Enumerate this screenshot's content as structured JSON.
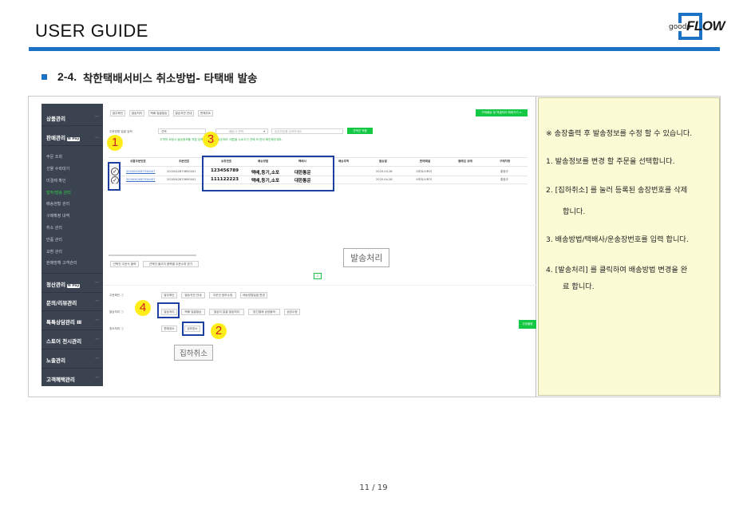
{
  "header": {
    "title": "USER GUIDE",
    "logo_small": "goods",
    "logo_big": "FLOW"
  },
  "section": {
    "number": "2-4.",
    "title": "착한택배서비스 취소방법- 타택배 발송"
  },
  "sidebar": {
    "heads": [
      "상품관리",
      "판매관리",
      "정산관리",
      "문의/리뷰관리",
      "톡톡상담관리",
      "스토어 전시관리",
      "노출관리",
      "고객혜택관리"
    ],
    "npay": "N Pay",
    "talk_icon": "Ⅲ",
    "items": [
      "주문 조회",
      "선물 수락대기",
      "미결제 확인",
      "발주/발송 관리",
      "배송현황 관리",
      "구매확정 내역",
      "취소 관리",
      "반품 관리",
      "교환 관리",
      "판매방해 고객관리"
    ]
  },
  "toolbar": {
    "top_buttons": [
      "발주확인",
      "발송처리",
      "택배 일괄발송",
      "발송지연 안내",
      "판매취소"
    ],
    "excel_button": "구매배송 및 엑셀처리 해제가기 >",
    "select_label": "주문방법 일괄 입력",
    "select_value": "선택",
    "select2_value": "배송사 선택",
    "input_placeholder": "송장번호를 입력하세요",
    "apply_button": "선택건 적용",
    "green_note": "· 고객의 요청시 발송정보를 직접 입력할 수 있는 '발송처리' 버튼을 누르시기 전에 꼭 먼저 확인해주세요."
  },
  "table": {
    "headers": [
      "상품주문번호",
      "주문번호",
      "송장번호",
      "배송방법",
      "택배사",
      "배송추적",
      "발송일",
      "판매채널",
      "클레임 상태",
      "구매자명"
    ],
    "rows": [
      {
        "product_order": "2020042087534437",
        "order": "2020042870690041",
        "invoice": "123456789",
        "method": "택배,등기,소포",
        "carrier": "대한통운",
        "ship_date": "2020.04.28",
        "channel": "스마트스토어",
        "buyer": "홍중규"
      },
      {
        "product_order": "2020042087534437",
        "order": "2020042870690041",
        "invoice": "111122223",
        "method": "택배,등기,소포",
        "carrier": "대한통운",
        "ship_date": "2020.04.28",
        "channel": "스마트스토어",
        "buyer": "홍중규"
      }
    ]
  },
  "bottom_bar": {
    "buttons": [
      "선택건 주문서 출력",
      "선택건 출고지 품목별 주문수취 받기"
    ],
    "page": "1"
  },
  "actions": {
    "row1": {
      "label": "주문확인 ⓘ",
      "buttons": [
        "발주확인",
        "발송지연 안내",
        "주문건 정보수정",
        "배송방법일괄 변경"
      ]
    },
    "row2": {
      "label": "발송처리 ⓘ",
      "buttons": [
        "발송처리",
        "택배 일괄발송",
        "발송지 일괄 발송처리",
        "맞긴결제 송장출력",
        "송장수정"
      ]
    },
    "row3": {
      "label": "취소처리 ⓘ",
      "buttons": [
        "판매취소",
        "집하취소"
      ]
    },
    "right_button": "수정불량"
  },
  "callouts": [
    "1",
    "2",
    "3",
    "4"
  ],
  "tooltips": {
    "ship": "발송처리",
    "cancel": "집하취소"
  },
  "notes": [
    "※ 송장출력 후  발송정보를 수정 할 수 있습니다.",
    "1.   발송정보를 변경 할 주문을 선택합니다.",
    "2.   [집하취소] 를 눌러 등록된 송장번호를 삭제",
    "합니다.",
    "3.    배송방법/택배사/운송장번호를 입력 합니다.",
    "4.    [발송처리] 를 클릭하여 배송방법 변경을 완",
    "료 합니다."
  ],
  "footer": {
    "page": "11 / 19"
  },
  "colors": {
    "accent": "#1c72c4",
    "callout": "#ffed1a",
    "callout_text": "#d41f1f",
    "sidebar": "#3b4350",
    "green": "#14c845",
    "note_bg": "#fbfbd6"
  }
}
